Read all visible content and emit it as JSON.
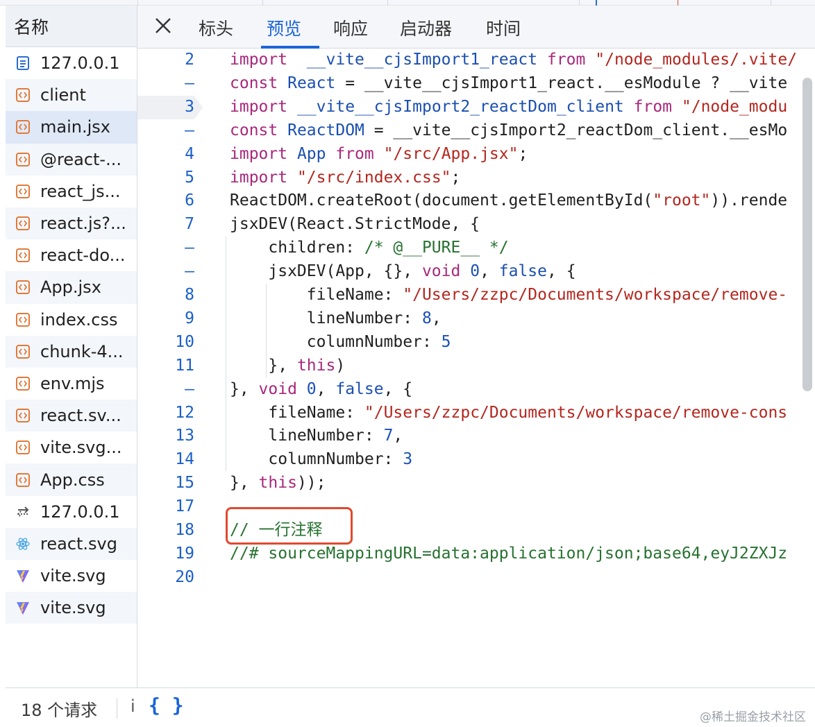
{
  "sidebar": {
    "header": "名称",
    "files": [
      {
        "name": "127.0.0.1",
        "icon": "document-icon"
      },
      {
        "name": "client",
        "icon": "script-file-icon"
      },
      {
        "name": "main.jsx",
        "icon": "script-file-icon",
        "selected": true
      },
      {
        "name": "@react-...",
        "icon": "script-file-icon"
      },
      {
        "name": "react_js...",
        "icon": "script-file-icon"
      },
      {
        "name": "react.js?...",
        "icon": "script-file-icon"
      },
      {
        "name": "react-do...",
        "icon": "script-file-icon"
      },
      {
        "name": "App.jsx",
        "icon": "script-file-icon"
      },
      {
        "name": "index.css",
        "icon": "script-file-icon"
      },
      {
        "name": "chunk-4...",
        "icon": "script-file-icon"
      },
      {
        "name": "env.mjs",
        "icon": "script-file-icon"
      },
      {
        "name": "react.sv...",
        "icon": "script-file-icon"
      },
      {
        "name": "vite.svg...",
        "icon": "script-file-icon"
      },
      {
        "name": "App.css",
        "icon": "script-file-icon"
      },
      {
        "name": "127.0.0.1",
        "icon": "websocket-icon"
      },
      {
        "name": "react.svg",
        "icon": "react-logo-icon"
      },
      {
        "name": "vite.svg",
        "icon": "vite-logo-icon"
      },
      {
        "name": "vite.svg",
        "icon": "vite-logo-icon"
      }
    ]
  },
  "tabs": [
    {
      "label": "标头",
      "active": false
    },
    {
      "label": "预览",
      "active": true
    },
    {
      "label": "响应",
      "active": false
    },
    {
      "label": "启动器",
      "active": false
    },
    {
      "label": "时间",
      "active": false
    }
  ],
  "code_lines": [
    {
      "ln": "2",
      "tokens": [
        [
          "k",
          "import"
        ],
        [
          "",
          "  "
        ],
        [
          "v",
          "__vite__cjsImport1_react"
        ],
        [
          "",
          ""
        ],
        [
          "k",
          " from"
        ],
        [
          "",
          " "
        ],
        [
          "s",
          "\"/node_modules/.vite/"
        ]
      ]
    },
    {
      "ln": "–",
      "tokens": [
        [
          "k",
          "const"
        ],
        [
          "",
          " "
        ],
        [
          "v",
          "React"
        ],
        [
          "",
          " = __vite__cjsImport1_react.__esModule ? __vite"
        ]
      ]
    },
    {
      "ln": "3",
      "tokens": [
        [
          "k",
          "import"
        ],
        [
          "",
          " "
        ],
        [
          "v",
          "__vite__cjsImport2_reactDom_client"
        ],
        [
          "",
          " "
        ],
        [
          "k",
          "from"
        ],
        [
          "",
          " "
        ],
        [
          "s",
          "\"/node_modu"
        ]
      ]
    },
    {
      "ln": "–",
      "tokens": [
        [
          "k",
          "const"
        ],
        [
          "",
          " "
        ],
        [
          "v",
          "ReactDOM"
        ],
        [
          "",
          " = __vite__cjsImport2_reactDom_client.__esMo"
        ]
      ]
    },
    {
      "ln": "4",
      "tokens": [
        [
          "k",
          "import"
        ],
        [
          "",
          " "
        ],
        [
          "v",
          "App"
        ],
        [
          "",
          " "
        ],
        [
          "k",
          "from"
        ],
        [
          "",
          " "
        ],
        [
          "s",
          "\"/src/App.jsx\""
        ],
        [
          "",
          ";"
        ]
      ]
    },
    {
      "ln": "5",
      "tokens": [
        [
          "k",
          "import"
        ],
        [
          "",
          " "
        ],
        [
          "s",
          "\"/src/index.css\""
        ],
        [
          "",
          ";"
        ]
      ]
    },
    {
      "ln": "6",
      "tokens": [
        [
          "",
          "ReactDOM.createRoot(document.getElementById("
        ],
        [
          "s",
          "\"root\""
        ],
        [
          "",
          "))."
        ],
        [
          "",
          "rende"
        ]
      ]
    },
    {
      "ln": "7",
      "tokens": [
        [
          "",
          "jsxDEV(React.StrictMode, {"
        ]
      ]
    },
    {
      "ln": "–",
      "tokens": [
        [
          "",
          "    children: "
        ],
        [
          "c",
          "/* @__PURE__ */"
        ]
      ]
    },
    {
      "ln": "–",
      "tokens": [
        [
          "",
          "    jsxDEV(App, {}, "
        ],
        [
          "k",
          "void"
        ],
        [
          "",
          " "
        ],
        [
          "n",
          "0"
        ],
        [
          "",
          ", "
        ],
        [
          "v",
          "false"
        ],
        [
          "",
          ", {"
        ]
      ]
    },
    {
      "ln": "8",
      "tokens": [
        [
          "",
          "        fileName: "
        ],
        [
          "s",
          "\"/Users/zzpc/Documents/workspace/remove-"
        ]
      ]
    },
    {
      "ln": "9",
      "tokens": [
        [
          "",
          "        lineNumber: "
        ],
        [
          "n",
          "8"
        ],
        [
          "",
          ","
        ]
      ]
    },
    {
      "ln": "10",
      "tokens": [
        [
          "",
          "        columnNumber: "
        ],
        [
          "n",
          "5"
        ]
      ]
    },
    {
      "ln": "11",
      "tokens": [
        [
          "",
          "    }, "
        ],
        [
          "k",
          "this"
        ],
        [
          "",
          ")"
        ]
      ]
    },
    {
      "ln": "–",
      "tokens": [
        [
          "",
          "}, "
        ],
        [
          "k",
          "void"
        ],
        [
          "",
          " "
        ],
        [
          "n",
          "0"
        ],
        [
          "",
          ", "
        ],
        [
          "v",
          "false"
        ],
        [
          "",
          ", {"
        ]
      ]
    },
    {
      "ln": "12",
      "tokens": [
        [
          "",
          "    fileName: "
        ],
        [
          "s",
          "\"/Users/zzpc/Documents/workspace/remove-cons"
        ]
      ]
    },
    {
      "ln": "13",
      "tokens": [
        [
          "",
          "    lineNumber: "
        ],
        [
          "n",
          "7"
        ],
        [
          "",
          ","
        ]
      ]
    },
    {
      "ln": "14",
      "tokens": [
        [
          "",
          "    columnNumber: "
        ],
        [
          "n",
          "3"
        ]
      ]
    },
    {
      "ln": "15",
      "tokens": [
        [
          "",
          "}, "
        ],
        [
          "k",
          "this"
        ],
        [
          "",
          "));"
        ]
      ]
    },
    {
      "ln": "17",
      "tokens": []
    },
    {
      "ln": "18",
      "tokens": [
        [
          "c",
          "// 一行注释"
        ]
      ]
    },
    {
      "ln": "19",
      "tokens": [
        [
          "c",
          "//# sourceMappingURL=data:application/json;base64,eyJ2ZXJz"
        ]
      ]
    },
    {
      "ln": "20",
      "tokens": []
    }
  ],
  "bottom_bar": {
    "request_count": "18 个请求",
    "info": "i",
    "pretty_print": "{ }"
  },
  "watermark": "@稀土掘金技术社区",
  "colors": {
    "accent": "#1a64d8",
    "keyword": "#a8287b",
    "string": "#b3261e",
    "comment": "#26712f",
    "highlight_box": "#e0492f"
  }
}
